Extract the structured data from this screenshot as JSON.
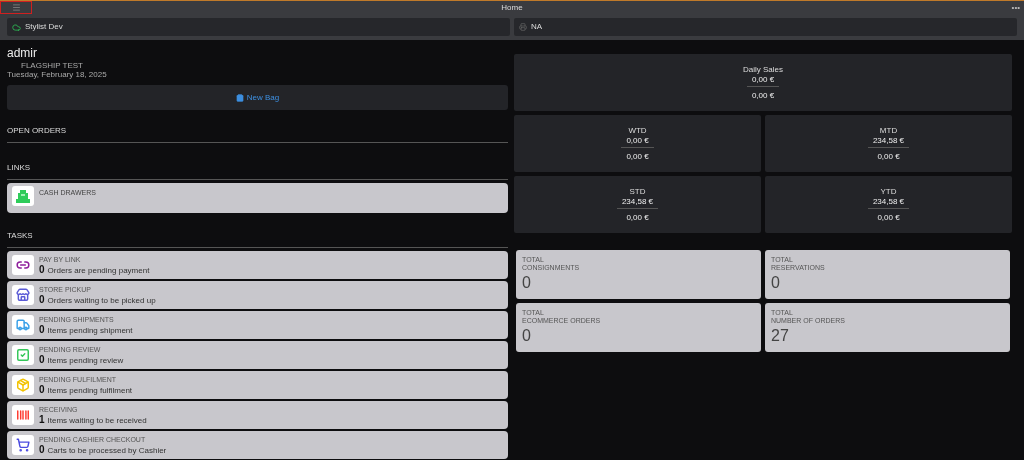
{
  "window": {
    "title": "Home",
    "more": "•••"
  },
  "header": {
    "app": "Stylist Dev",
    "printer": "NA"
  },
  "user": {
    "name": "admir",
    "store": "FLAGSHIP TEST",
    "date": "Tuesday, February 18, 2025"
  },
  "new_bag": "New Bag",
  "sections": {
    "open_orders": "OPEN ORDERS",
    "links": "LINKS",
    "tasks": "TASKS"
  },
  "links": [
    {
      "kind": "register",
      "label": "CASH DRAWERS"
    }
  ],
  "tasks": [
    {
      "kind": "link",
      "label": "PAY BY LINK",
      "count": "0",
      "text": "Orders are pending payment"
    },
    {
      "kind": "store",
      "label": "STORE PICKUP",
      "count": "0",
      "text": "Orders waiting to be picked up"
    },
    {
      "kind": "truck",
      "label": "PENDING SHIPMENTS",
      "count": "0",
      "text": "Items pending shipment"
    },
    {
      "kind": "check",
      "label": "PENDING REVIEW",
      "count": "0",
      "text": "Items pending review"
    },
    {
      "kind": "box",
      "label": "PENDING FULFILMENT",
      "count": "0",
      "text": "Items pending fulfilment"
    },
    {
      "kind": "barcode",
      "label": "RECEIVING",
      "count": "1",
      "text": "Items waiting to be received"
    },
    {
      "kind": "cart",
      "label": "PENDING CASHIER CHECKOUT",
      "count": "0",
      "text": "Carts to be processed by Cashier"
    }
  ],
  "sales": [
    {
      "title": "Daily Sales",
      "value": "0,00 €",
      "secondary": "0,00 €"
    },
    {
      "title": "WTD",
      "value": "0,00 €",
      "secondary": "0,00 €"
    },
    {
      "title": "MTD",
      "value": "234,58 €",
      "secondary": "0,00 €"
    },
    {
      "title": "STD",
      "value": "234,58 €",
      "secondary": "0,00 €"
    },
    {
      "title": "YTD",
      "value": "234,58 €",
      "secondary": "0,00 €"
    }
  ],
  "totals": [
    {
      "prefix": "TOTAL",
      "label": "CONSIGNMENTS",
      "value": "0"
    },
    {
      "prefix": "TOTAL",
      "label": "RESERVATIONS",
      "value": "0"
    },
    {
      "prefix": "TOTAL",
      "label": "ECOMMERCE ORDERS",
      "value": "0"
    },
    {
      "prefix": "TOTAL",
      "label": "NUMBER OF ORDERS",
      "value": "27"
    }
  ]
}
